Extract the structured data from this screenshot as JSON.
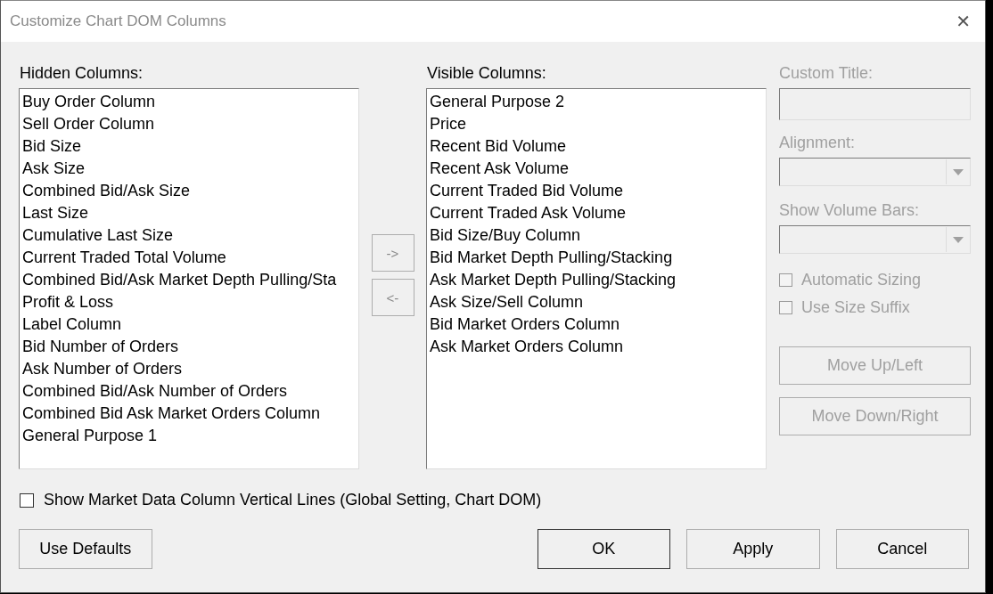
{
  "window": {
    "title": "Customize Chart DOM Columns",
    "close": "✕"
  },
  "hidden_columns": {
    "label": "Hidden Columns:",
    "items": [
      {
        "text": "Buy Order Column",
        "selected": false
      },
      {
        "text": "Sell Order Column",
        "selected": false
      },
      {
        "text": "Bid Size",
        "selected": false
      },
      {
        "text": "Ask Size",
        "selected": false
      },
      {
        "text": "Combined Bid/Ask Size",
        "selected": false
      },
      {
        "text": "Last Size",
        "selected": false
      },
      {
        "text": "Cumulative Last Size",
        "selected": false
      },
      {
        "text": "Current Traded Total Volume",
        "selected": false
      },
      {
        "text": "Combined Bid/Ask Market Depth Pulling/Sta",
        "selected": false
      },
      {
        "text": "Profit & Loss",
        "selected": false
      },
      {
        "text": "Label Column",
        "selected": false
      },
      {
        "text": "Bid Number of Orders",
        "selected": false
      },
      {
        "text": "Ask Number of Orders",
        "selected": false
      },
      {
        "text": "Combined Bid/Ask Number of Orders",
        "selected": false
      },
      {
        "text": "Combined Bid Ask Market Orders Column",
        "selected": false
      },
      {
        "text": "General Purpose 1",
        "selected": false
      }
    ]
  },
  "move_buttons": [
    {
      "label": "->",
      "disabled": true
    },
    {
      "label": "<-",
      "disabled": true
    }
  ],
  "visible_columns": {
    "label": "Visible Columns:",
    "items": [
      {
        "text": "General Purpose 2",
        "selected": false
      },
      {
        "text": "Price",
        "selected": false
      },
      {
        "text": "Recent Bid Volume",
        "selected": false
      },
      {
        "text": "Recent Ask Volume",
        "selected": false
      },
      {
        "text": "Current Traded Bid Volume",
        "selected": false
      },
      {
        "text": "Current Traded Ask Volume",
        "selected": false
      },
      {
        "text": "Bid Size/Buy Column",
        "selected": false
      },
      {
        "text": "Bid Market Depth Pulling/Stacking",
        "selected": false
      },
      {
        "text": "Ask Market Depth Pulling/Stacking",
        "selected": false
      },
      {
        "text": "Ask Size/Sell Column",
        "selected": false
      },
      {
        "text": "Bid Market Orders Column",
        "selected": false
      },
      {
        "text": "Ask Market Orders Column",
        "selected": false
      }
    ]
  },
  "properties": {
    "disabled": true,
    "custom_title": {
      "label": "Custom Title:"
    },
    "alignment": {
      "label": "Alignment:"
    },
    "show_volume_bars": {
      "label": "Show Volume Bars:"
    },
    "checkboxes": [
      {
        "label": "Automatic Sizing",
        "checked": false
      },
      {
        "label": "Use Size Suffix",
        "checked": false
      }
    ],
    "buttons": [
      {
        "label": "Move Up/Left",
        "disabled": true
      },
      {
        "label": "Move Down/Right",
        "disabled": true
      }
    ]
  },
  "global_option": {
    "label": "Show Market Data Column Vertical Lines (Global Setting, Chart DOM)",
    "checked": false
  },
  "buttons": [
    {
      "label": "Use Defaults",
      "kind": "left"
    },
    {
      "label": "OK",
      "kind": "default"
    },
    {
      "label": "Apply",
      "kind": "normal"
    },
    {
      "label": "Cancel",
      "kind": "normal"
    }
  ]
}
